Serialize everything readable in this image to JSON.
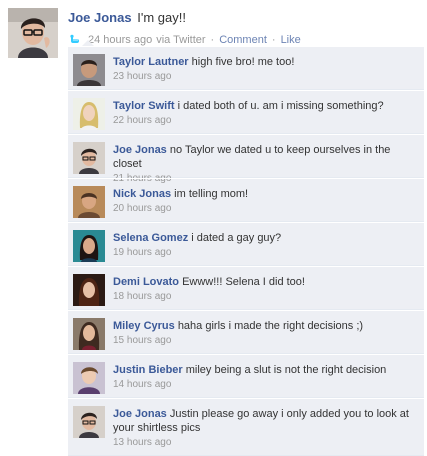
{
  "post": {
    "author": "Joe Jonas",
    "text": "I'm gay!!",
    "avatar_icon": "person-with-glasses-avatar",
    "meta": {
      "time": "24 hours ago",
      "via": "via Twitter",
      "separator": "·",
      "comment_label": "Comment",
      "like_label": "Like",
      "source_icon": "twitter-bird-icon"
    }
  },
  "comments": [
    {
      "author": "Taylor Lautner",
      "text": "high five bro! me too!",
      "time": "23 hours ago",
      "avatar_color": "#5b4a3e"
    },
    {
      "author": "Taylor Swift",
      "text": "i dated both of u. am i missing something?",
      "time": "22 hours ago",
      "avatar_color": "#d9c27a"
    },
    {
      "author": "Joe Jonas",
      "text": "no Taylor we dated u to keep ourselves in the closet",
      "time": "21 hours ago",
      "avatar_color": "#3a2e2a"
    },
    {
      "author": "Nick Jonas",
      "text": "im telling mom!",
      "time": "20 hours ago",
      "avatar_color": "#8a6a4a"
    },
    {
      "author": "Selena Gomez",
      "text": "i dated a gay guy?",
      "time": "19 hours ago",
      "avatar_color": "#2f8a8e"
    },
    {
      "author": "Demi Lovato",
      "text": "Ewww!!! Selena I did too!",
      "time": "18 hours ago",
      "avatar_color": "#4a2a1c"
    },
    {
      "author": "Miley Cyrus",
      "text": "haha girls i made the right decisions ;)",
      "time": "15 hours ago",
      "avatar_color": "#5a3d2f"
    },
    {
      "author": "Justin Bieber",
      "text": "miley being a slut is not the right decision",
      "time": "14 hours ago",
      "avatar_color": "#6a5870"
    },
    {
      "author": "Joe Jonas",
      "text": "Justin please go away i only added you to look at your shirtless pics",
      "time": "13 hours ago",
      "avatar_color": "#3a2e2a"
    }
  ],
  "colors": {
    "link_blue": "#3b5998",
    "meta_link": "#6d84b4",
    "comment_bg": "#edeff4",
    "timestamp": "#999999",
    "twitter_blue": "#33ccff"
  }
}
